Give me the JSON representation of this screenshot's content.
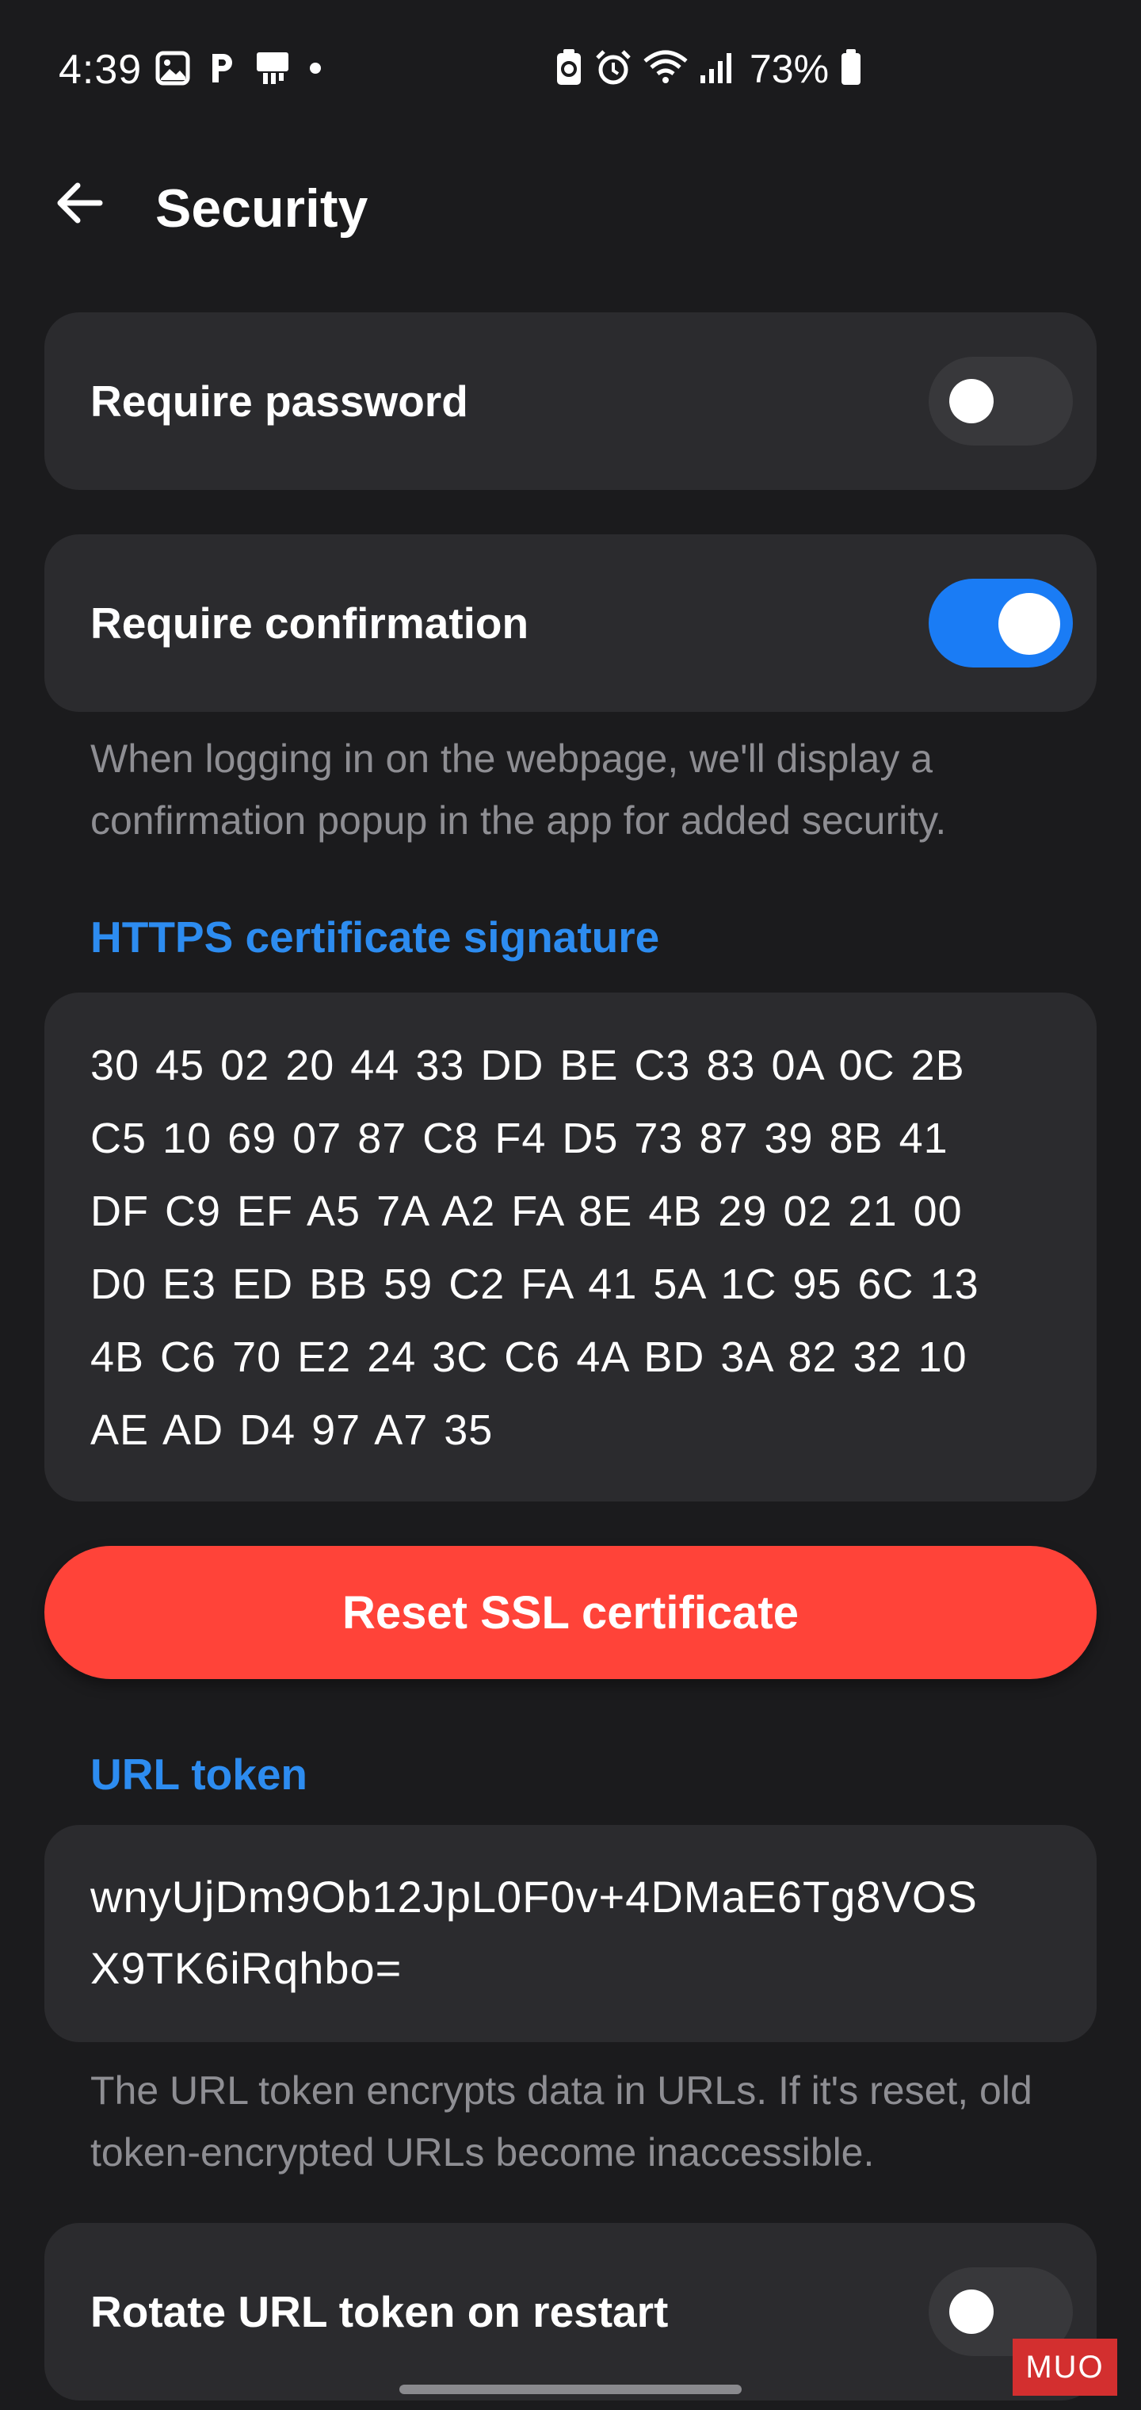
{
  "status_bar": {
    "time": "4:39",
    "battery": "73%",
    "left_icons": [
      "gallery-icon",
      "p-icon",
      "cast-icon",
      "dot-icon"
    ],
    "right_icons": [
      "battery-saver-icon",
      "alarm-icon",
      "wifi-icon",
      "signal-icon",
      "battery-icon"
    ]
  },
  "header": {
    "title": "Security"
  },
  "settings": {
    "require_password": {
      "label": "Require password",
      "enabled": false
    },
    "require_confirmation": {
      "label": "Require confirmation",
      "enabled": true,
      "description": "When logging in on the webpage, we'll display a confirmation popup in the app for added security."
    },
    "https_certificate": {
      "section_title": "HTTPS certificate signature",
      "lines": [
        "30 45 02 20 44 33 DD BE C3 83 0A 0C 2B",
        "C5 10 69 07 87 C8 F4 D5 73 87 39 8B 41",
        "DF C9 EF A5 7A A2 FA 8E 4B 29 02 21 00",
        "D0 E3 ED BB 59 C2 FA 41 5A 1C 95 6C 13",
        "4B C6 70 E2 24 3C C6 4A BD 3A 82 32 10",
        "AE AD D4 97 A7 35"
      ]
    },
    "reset_ssl_button": "Reset SSL certificate",
    "url_token": {
      "section_title": "URL token",
      "lines": [
        "wnyUjDm9Ob12JpL0F0v+4DMaE6Tg8VOS",
        "X9TK6iRqhbo="
      ],
      "description": "The URL token encrypts data in URLs. If it's reset, old token-encrypted URLs become inaccessible."
    },
    "rotate_url_token": {
      "label": "Rotate URL token on restart",
      "enabled": false
    }
  },
  "watermark": "MUO",
  "colors": {
    "background": "#1b1b1d",
    "card": "#2b2b2e",
    "accent_blue": "#2d8cf0",
    "toggle_on": "#1a7cf5",
    "danger_red": "#ff4339",
    "muted_text": "#8e8e93"
  }
}
